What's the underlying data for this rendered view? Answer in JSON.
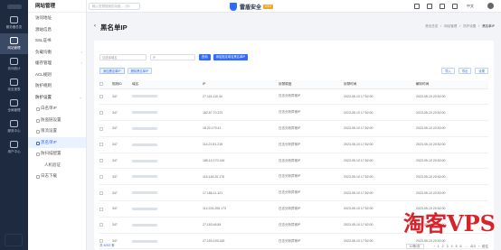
{
  "topbar": {
    "search_placeholder": "输入您想搜索的功能…  ⌘K",
    "brand_name": "雷盾安全",
    "brand_version": "V3.0",
    "lang": "中文"
  },
  "rail": [
    {
      "label": "服务器总览",
      "icon": "dashboard-icon"
    },
    {
      "label": "网站管理",
      "icon": "website-icon",
      "active": true
    },
    {
      "label": "访问统计",
      "icon": "stats-icon"
    },
    {
      "label": "攻击报表",
      "icon": "report-icon"
    },
    {
      "label": "全局管理",
      "icon": "global-icon"
    },
    {
      "label": "服务中心",
      "icon": "service-icon"
    },
    {
      "label": "用户中心",
      "icon": "user-icon"
    }
  ],
  "submenu": {
    "title": "网站管理",
    "items": [
      {
        "label": "访问地址",
        "type": "item"
      },
      {
        "label": "源站信息",
        "type": "item"
      },
      {
        "label": "SSL证书",
        "type": "item"
      },
      {
        "label": "负载均衡",
        "type": "item",
        "arrow": "›"
      },
      {
        "label": "缓存管理",
        "type": "item",
        "arrow": "›"
      },
      {
        "label": "ACL规则",
        "type": "item"
      },
      {
        "label": "防护规则",
        "type": "item"
      },
      {
        "label": "防护设置",
        "type": "open",
        "arrow": "⌄"
      },
      {
        "label": "白名单IP",
        "type": "child"
      },
      {
        "label": "防盗链设置",
        "type": "child"
      },
      {
        "label": "限流设置",
        "type": "child"
      },
      {
        "label": "黑名单IP",
        "type": "child",
        "active": true
      },
      {
        "label": "防扫描配置",
        "type": "child"
      },
      {
        "label": "人机验证",
        "type": "child2"
      },
      {
        "label": "日志下载",
        "type": "child"
      }
    ]
  },
  "page": {
    "back": "‹",
    "title": "黑名单IP",
    "breadcrumbs": [
      "首页总览",
      "网站管理",
      "防护设置",
      "黑名单IP"
    ]
  },
  "filters": {
    "domain_placeholder": "请选择域名",
    "ip_placeholder": "IP",
    "search_label": "查询",
    "add_label": "添加指定域名黑名单IP"
  },
  "actions": {
    "batch_add": "添加黑名单IP",
    "batch_delete": "删除黑名单IP",
    "import": "导入",
    "export": "导出",
    "settings": "设置"
  },
  "table": {
    "headers": [
      "",
      "规则ID",
      "域名",
      "IP",
      "封禁原因",
      "封禁时间",
      "解封时间"
    ],
    "rows": [
      {
        "id": "347",
        "ip": "27.116.110.34",
        "reason": "日志分析异常IP",
        "start": "2023-05-10 17:52:00",
        "end": "2023-05-10 20:52:00"
      },
      {
        "id": "347",
        "ip": "182.57.70.221",
        "reason": "日志分析异常IP",
        "start": "2023-05-10 17:52:00",
        "end": "2023-05-10 20:52:00"
      },
      {
        "id": "347",
        "ip": "18.20.179.41",
        "reason": "日志分析异常IP",
        "start": "2023-05-10 17:52:00",
        "end": "2023-05-10 20:52:00"
      },
      {
        "id": "347",
        "ip": "114.21.81.215",
        "reason": "日志分析异常IP",
        "start": "2023-05-10 17:52:00",
        "end": "2023-05-10 20:52:00"
      },
      {
        "id": "347",
        "ip": "185.10.170.146",
        "reason": "日志分析异常IP",
        "start": "2023-05-10 17:52:00",
        "end": "2023-05-10 20:52:00"
      },
      {
        "id": "347",
        "ip": "116.145.20.176",
        "reason": "日志分析异常IP",
        "start": "2023-05-10 17:52:00",
        "end": "2023-05-10 20:52:00"
      },
      {
        "id": "347",
        "ip": "17.186.11.121",
        "reason": "日志分析异常IP",
        "start": "2023-05-10 17:52:00",
        "end": "2023-05-10 20:52:00"
      },
      {
        "id": "347",
        "ip": "114.224.206.173",
        "reason": "日志分析异常IP",
        "start": "2023-05-10 17:52:00",
        "end": "2023-05-10 20:52:00"
      },
      {
        "id": "347",
        "ip": "27.153.46.84",
        "reason": "日志分析异常IP",
        "start": "2023-05-10 17:52:00",
        "end": "2023-05-10 20:52:00"
      },
      {
        "id": "347",
        "ip": "27.153.193.145",
        "reason": "日志分析异常IP",
        "start": "2023-05-10 17:52:00",
        "end": "2023-05-10 20:52:00"
      }
    ]
  },
  "footer": {
    "total_prefix": "共",
    "total_count": "4093",
    "total_suffix": "条",
    "page_size": "10条/页",
    "pages": [
      "‹",
      "1",
      "2",
      "3",
      "4",
      "5",
      "6",
      "…",
      "410",
      "›"
    ],
    "goto": "前往"
  },
  "watermark": "淘客VPS",
  "colors": {
    "accent": "#2f6bff",
    "rail_bg": "#1d2a3f",
    "brand_badge": "#f6a623",
    "watermark": "#d8232a"
  }
}
